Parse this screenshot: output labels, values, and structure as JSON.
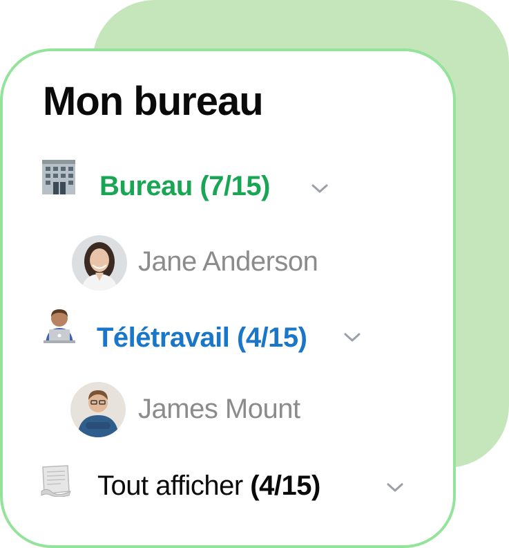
{
  "widget": {
    "title": "Mon bureau"
  },
  "sections": [
    {
      "icon": "office-building-icon",
      "label": "Bureau (7/15)",
      "color": "#19a654",
      "members": [
        {
          "name": "Jane Anderson",
          "avatar": "woman-avatar"
        }
      ]
    },
    {
      "icon": "remote-worker-laptop-icon",
      "label": "Télétravail (4/15)",
      "color": "#1976c8",
      "members": [
        {
          "name": "James Mount",
          "avatar": "man-avatar"
        }
      ]
    },
    {
      "icon": "document-icon",
      "label_text": "Tout afficher",
      "label_count": "(4/15)",
      "color": "#0a0a0a"
    }
  ],
  "colors": {
    "card_border": "#93e39b",
    "back_card": "#c5e5bb",
    "chevron": "#9aa0a8",
    "member_name": "#8b8b8b"
  }
}
